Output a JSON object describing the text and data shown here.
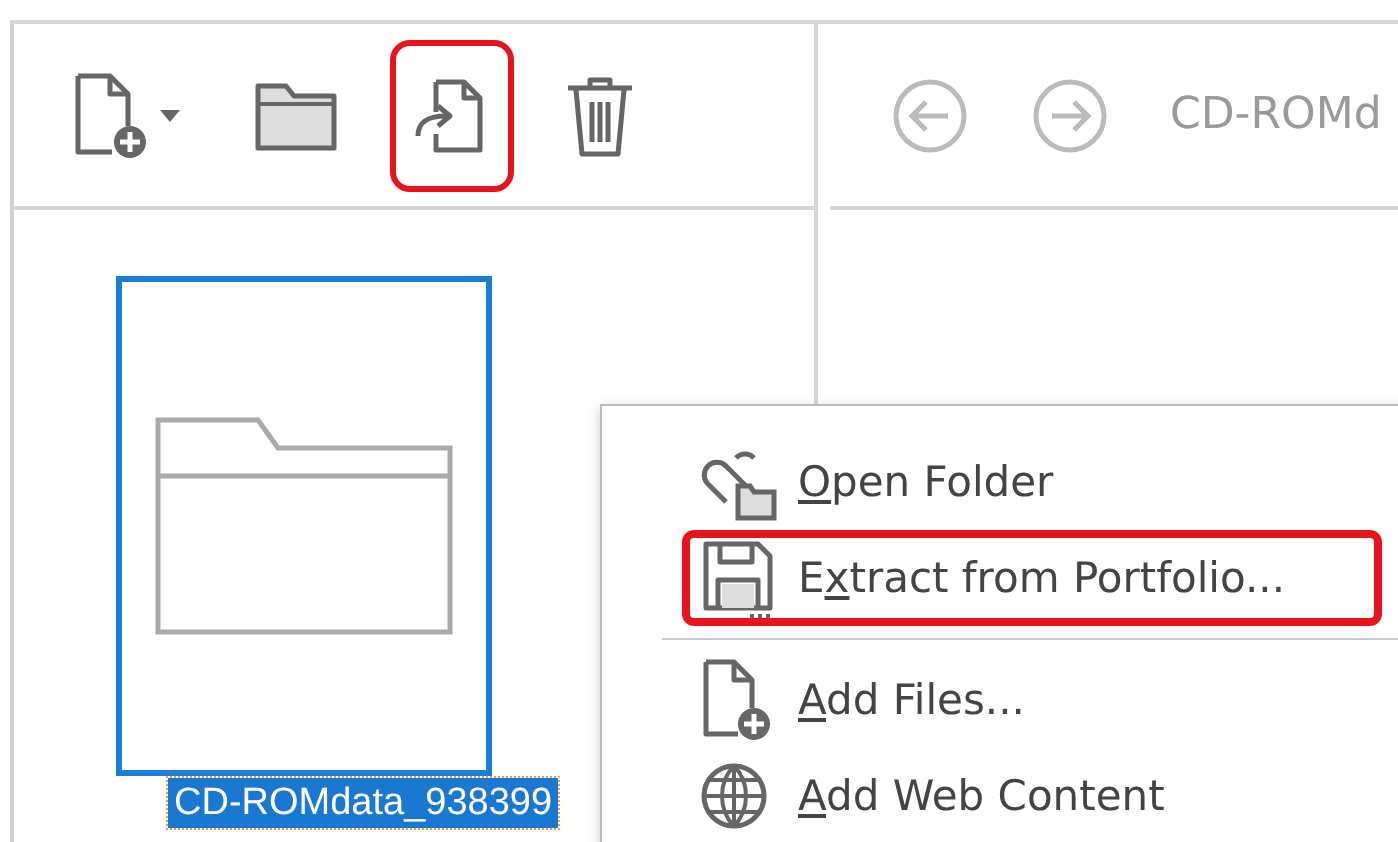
{
  "toolbar": {
    "buttons": [
      {
        "kind": "new-file",
        "dropdown": true,
        "highlighted": false
      },
      {
        "kind": "folder",
        "dropdown": false,
        "highlighted": false
      },
      {
        "kind": "extract",
        "dropdown": false,
        "highlighted": true
      },
      {
        "kind": "delete",
        "dropdown": false,
        "highlighted": false
      }
    ]
  },
  "navigation": {
    "path": "CD-ROMd"
  },
  "item": {
    "name": "CD-ROMdata_938399",
    "selected": true
  },
  "context_menu": [
    {
      "kind": "open-folder",
      "key": "O",
      "after": "pen Folder",
      "highlighted": false
    },
    {
      "kind": "extract",
      "before": "E",
      "key": "x",
      "after": "tract from Portfolio...",
      "highlighted": true
    },
    {
      "kind": "separator"
    },
    {
      "kind": "add-files",
      "key": "A",
      "after": "dd Files...",
      "highlighted": false
    },
    {
      "kind": "add-web",
      "key": "A",
      "after": "dd Web Content",
      "highlighted": false
    }
  ]
}
